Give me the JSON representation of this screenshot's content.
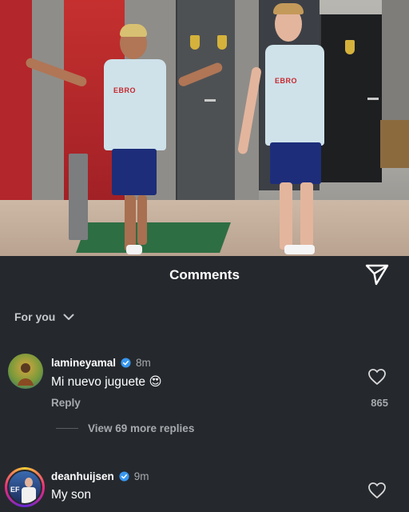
{
  "sheet": {
    "title": "Comments",
    "filter_label": "For you"
  },
  "photo": {
    "sponsor_left": "EBRO",
    "sponsor_right": "EBRO"
  },
  "comments": [
    {
      "username": "lamineyamal",
      "verified": true,
      "time": "8m",
      "text": "Mi nuevo juguete",
      "emoji": "😍",
      "reply_label": "Reply",
      "likes": "865",
      "view_more": "View 69 more replies"
    },
    {
      "username": "deanhuijsen",
      "verified": true,
      "time": "9m",
      "text": "My son"
    }
  ],
  "icons": {
    "send": "send-icon",
    "like": "heart-icon",
    "chevron": "chevron-down-icon",
    "verified": "verified-badge-icon"
  },
  "colors": {
    "background": "#25292e",
    "verified": "#3897f0",
    "secondary_text": "#a7aaad",
    "avatar_ring": "#e1306c"
  }
}
